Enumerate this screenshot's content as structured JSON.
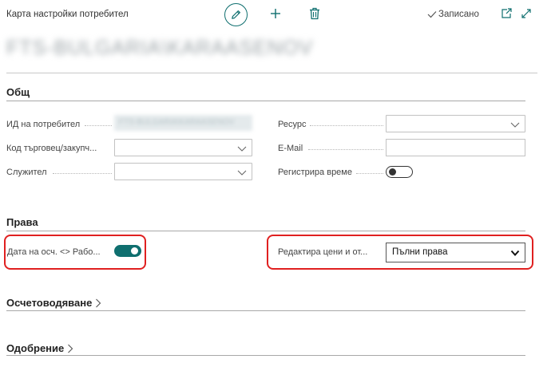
{
  "header": {
    "caption": "Карта настройки потребител",
    "saved_label": "Записано"
  },
  "record": {
    "title": "FTS-BULGARIA\\KARAASENOV"
  },
  "sections": {
    "general": {
      "title": "Общ"
    },
    "rights": {
      "title": "Права"
    },
    "accounting": {
      "title": "Осчетоводяване"
    },
    "approval": {
      "title": "Одобрение"
    }
  },
  "general_fields": {
    "user_id": {
      "label": "ИД на потребител",
      "value": "FTS-BULGARIA\\KARAASENOV"
    },
    "salesperson": {
      "label": "Код търговец/закупч...",
      "value": ""
    },
    "employee": {
      "label": "Служител",
      "value": ""
    },
    "resource": {
      "label": "Ресурс",
      "value": ""
    },
    "email": {
      "label": "E-Mail",
      "value": ""
    },
    "register_time": {
      "label": "Регистрира време",
      "checked": false
    }
  },
  "rights_fields": {
    "posting_date": {
      "label": "Дата на осч. <> Рабо...",
      "checked": true
    },
    "edit_prices": {
      "label": "Редактира цени и от...",
      "value": "Пълни права"
    }
  },
  "colors": {
    "accent": "#0f6f6f",
    "highlight": "#e02020"
  },
  "icons": [
    "edit-icon",
    "plus-icon",
    "trash-icon",
    "check-icon",
    "open-new-window-icon",
    "expand-icon",
    "chevron-down-icon",
    "chevron-right-icon"
  ]
}
